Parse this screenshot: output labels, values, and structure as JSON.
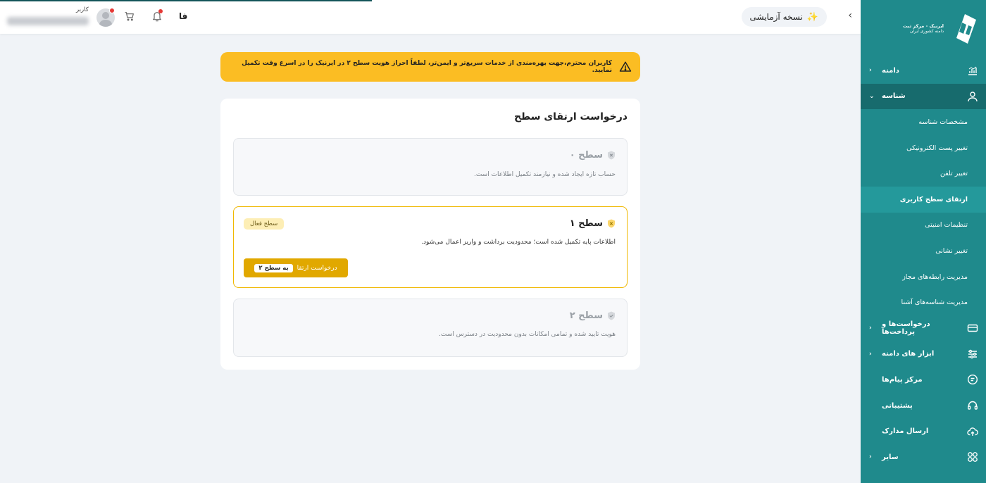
{
  "topbar": {
    "trial_label": "نسخه آزمایشی",
    "language": "فا",
    "user_label": "کاربر"
  },
  "banner": {
    "text": "کاربران محترم،جهت بهره‌مندی از خدمات سریع‌تر و ایمن‌تر، لطفاً احراز هویت سطح ۲ در ایرنیک را در اسرع وقت تکمیل نمایید."
  },
  "logo": {
    "line1": "ایرنیک - مرکز ثبت",
    "line2": "دامنه کشوری ایران"
  },
  "sidebar": {
    "items": [
      {
        "label": "دامنه",
        "icon": "domain-chart-icon",
        "has_chevron": true
      },
      {
        "label": "شناسه",
        "icon": "user-icon",
        "has_chevron": true,
        "expanded": true
      },
      {
        "label": "درخواست‌ها و پرداخت‌ها",
        "icon": "card-icon",
        "has_chevron": true
      },
      {
        "label": "ابزار های دامنه",
        "icon": "sliders-icon",
        "has_chevron": true
      },
      {
        "label": "مرکز پیام‌ها",
        "icon": "message-icon",
        "has_chevron": false
      },
      {
        "label": "پشتیبانی",
        "icon": "headset-icon",
        "has_chevron": false
      },
      {
        "label": "ارسال مدارک",
        "icon": "upload-cloud-icon",
        "has_chevron": false
      },
      {
        "label": "سایر",
        "icon": "grid-icon",
        "has_chevron": true
      }
    ],
    "subitems": [
      {
        "label": "مشخصات شناسه"
      },
      {
        "label": "تغییر پست الکترونیکی"
      },
      {
        "label": "تغییر تلفن"
      },
      {
        "label": "ارتقای سطح کاربری",
        "active": true
      },
      {
        "label": "تنظیمات امنیتی"
      },
      {
        "label": "تغییر نشانی"
      },
      {
        "label": "مدیریت رابطه‌های مجاز"
      },
      {
        "label": "مدیریت شناسه‌های آشنا"
      }
    ]
  },
  "main": {
    "title": "درخواست ارتقای سطح",
    "levels": [
      {
        "name": "سطح ۰",
        "description": "حساب تازه ایجاد شده و نیازمند تکمیل اطلاعات است."
      },
      {
        "name": "سطح ۱",
        "description": "اطلاعات پایه تکمیل شده است؛ محدودیت برداشت و واریز اعمال می‌شود.",
        "badge": "سطح فعال",
        "button_label": "درخواست ارتقا",
        "button_chip": "به سطح ۲"
      },
      {
        "name": "سطح ۲",
        "description": "هویت تایید شده و تمامی امکانات بدون محدودیت در دسترس است."
      }
    ]
  },
  "colors": {
    "sidebar": "#1f8a8c",
    "sidebar_expanded": "#176b6d",
    "sidebar_active": "#24999b",
    "banner": "#fbbd23",
    "accent": "#e1a800"
  }
}
